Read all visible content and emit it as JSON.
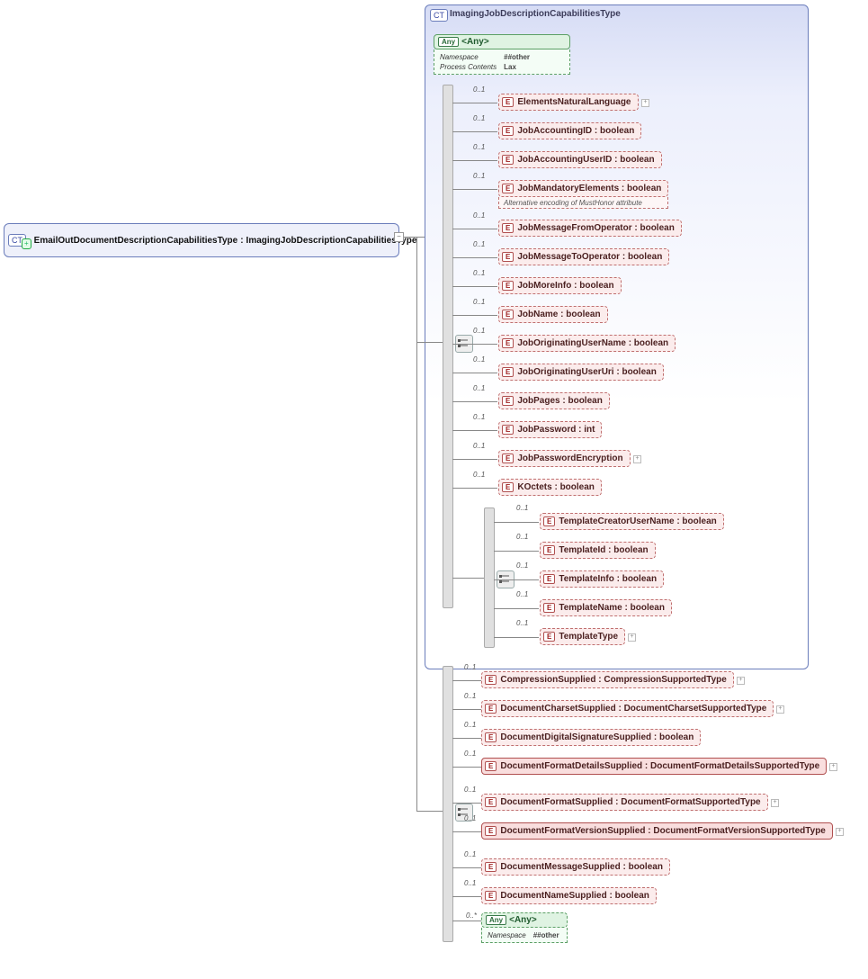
{
  "root_ct": {
    "badge": "CT",
    "name_left": "EmailOutDocumentDescriptionCapabilitiesType",
    "name_sep": " : ",
    "name_right": "ImagingJobDescriptionCapabilitiesType"
  },
  "panel": {
    "badge": "CT",
    "title": "ImagingJobDescriptionCapabilitiesType"
  },
  "any_top": {
    "badge": "Any",
    "label": "<Any>",
    "meta_ns_label": "Namespace",
    "meta_ns_val": "##other",
    "meta_pc_label": "Process Contents",
    "meta_pc_val": "Lax"
  },
  "occ": "0..1",
  "occ_star": "0..*",
  "inner_elements": [
    {
      "name": "ElementsNaturalLanguage",
      "type": "",
      "has_expand": true
    },
    {
      "name": "JobAccountingID",
      "type": "boolean"
    },
    {
      "name": "JobAccountingUserID",
      "type": "boolean"
    },
    {
      "name": "JobMandatoryElements",
      "type": "boolean",
      "note": "Alternative encoding of MustHonor attribute"
    },
    {
      "name": "JobMessageFromOperator",
      "type": "boolean"
    },
    {
      "name": "JobMessageToOperator",
      "type": "boolean"
    },
    {
      "name": "JobMoreInfo",
      "type": "boolean"
    },
    {
      "name": "JobName",
      "type": "boolean"
    },
    {
      "name": "JobOriginatingUserName",
      "type": "boolean"
    },
    {
      "name": "JobOriginatingUserUri",
      "type": "boolean"
    },
    {
      "name": "JobPages",
      "type": "boolean"
    },
    {
      "name": "JobPassword",
      "type": "int"
    },
    {
      "name": "JobPasswordEncryption",
      "type": "",
      "has_expand": true
    },
    {
      "name": "KOctets ",
      "type": "boolean"
    }
  ],
  "template_elements": [
    {
      "name": "TemplateCreatorUserName",
      "type": "boolean"
    },
    {
      "name": "TemplateId",
      "type": "boolean"
    },
    {
      "name": "TemplateInfo",
      "type": "boolean"
    },
    {
      "name": "TemplateName",
      "type": "boolean"
    },
    {
      "name": "TemplateType",
      "type": "",
      "has_expand": true
    }
  ],
  "outer_elements": [
    {
      "name": "CompressionSupplied",
      "type": "CompressionSupportedType",
      "has_expand": true
    },
    {
      "name": "DocumentCharsetSupplied",
      "type": "DocumentCharsetSupportedType",
      "has_expand": true
    },
    {
      "name": "DocumentDigitalSignatureSupplied",
      "type": "boolean"
    },
    {
      "name": "DocumentFormatDetailsSupplied",
      "type": "DocumentFormatDetailsSupportedType",
      "solid": true,
      "has_expand": true,
      "wide": true
    },
    {
      "name": "DocumentFormatSupplied",
      "type": "DocumentFormatSupportedType",
      "has_expand": true
    },
    {
      "name": "DocumentFormatVersionSupplied",
      "type": "DocumentFormatVersionSupportedType",
      "solid": true,
      "has_expand": true,
      "wide": true
    },
    {
      "name": "DocumentMessageSupplied",
      "type": "boolean"
    },
    {
      "name": "DocumentNameSupplied",
      "type": "boolean"
    }
  ],
  "any_bottom": {
    "badge": "Any",
    "label": "<Any>",
    "meta_ns_label": "Namespace",
    "meta_ns_val": "##other"
  },
  "e_label": "E"
}
